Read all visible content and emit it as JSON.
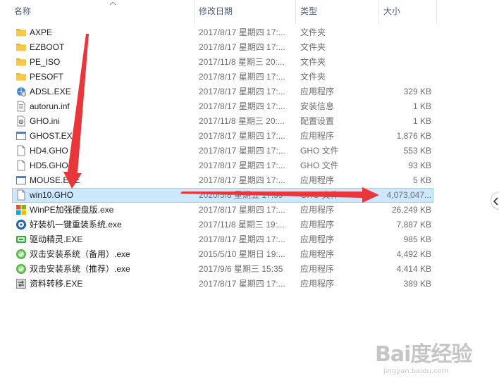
{
  "columns": {
    "name": "名称",
    "date": "修改日期",
    "type": "类型",
    "size": "大小"
  },
  "files": [
    {
      "name": "AXPE",
      "date": "2017/8/17 星期四 17:...",
      "type": "文件夹",
      "size": "",
      "icon": "folder-icon"
    },
    {
      "name": "EZBOOT",
      "date": "2017/8/17 星期四 17:...",
      "type": "文件夹",
      "size": "",
      "icon": "folder-icon"
    },
    {
      "name": "PE_ISO",
      "date": "2017/11/8 星期三 20:...",
      "type": "文件夹",
      "size": "",
      "icon": "folder-icon"
    },
    {
      "name": "PESOFT",
      "date": "2017/8/17 星期四 17:...",
      "type": "文件夹",
      "size": "",
      "icon": "folder-icon"
    },
    {
      "name": "ADSL.EXE",
      "date": "2017/8/17 星期四 17:...",
      "type": "应用程序",
      "size": "329 KB",
      "icon": "network-app-icon"
    },
    {
      "name": "autorun.inf",
      "date": "2017/8/17 星期四 17:...",
      "type": "安装信息",
      "size": "1 KB",
      "icon": "setup-info-icon"
    },
    {
      "name": "GHO.ini",
      "date": "2017/11/8 星期三 20:...",
      "type": "配置设置",
      "size": "1 KB",
      "icon": "config-file-icon"
    },
    {
      "name": "GHOST.EXE",
      "date": "2017/8/17 星期四 17:...",
      "type": "应用程序",
      "size": "1,876 KB",
      "icon": "app-window-icon"
    },
    {
      "name": "HD4.GHO",
      "date": "2017/8/17 星期四 17:...",
      "type": "GHO 文件",
      "size": "553 KB",
      "icon": "blank-file-icon"
    },
    {
      "name": "HD5.GHO",
      "date": "2017/8/17 星期四 17:...",
      "type": "GHO 文件",
      "size": "93 KB",
      "icon": "blank-file-icon"
    },
    {
      "name": "MOUSE.EXE",
      "date": "2017/8/17 星期四 17:...",
      "type": "应用程序",
      "size": "5 KB",
      "icon": "app-window-icon"
    },
    {
      "name": "win10.GHO",
      "date": "2020/5/8 星期五 17:59",
      "type": "GHO 文件",
      "size": "4,073,047...",
      "icon": "blank-file-icon",
      "selected": true
    },
    {
      "name": "WinPE加强硬盘版.exe",
      "date": "2017/8/17 星期四 17:...",
      "type": "应用程序",
      "size": "26,249 KB",
      "icon": "winpe-app-icon"
    },
    {
      "name": "好装机一键重装系统.exe",
      "date": "2017/11/8 星期三 19:...",
      "type": "应用程序",
      "size": "7,887 KB",
      "icon": "installer-disc-icon"
    },
    {
      "name": "驱动精灵.EXE",
      "date": "2017/8/17 星期四 17:...",
      "type": "应用程序",
      "size": "985 KB",
      "icon": "driver-app-icon"
    },
    {
      "name": "双击安装系统（备用）.exe",
      "date": "2015/5/10 星期日 19:...",
      "type": "应用程序",
      "size": "4,492 KB",
      "icon": "install-system-icon"
    },
    {
      "name": "双击安装系统（推荐）.exe",
      "date": "2017/9/6 星期三 15:35",
      "type": "应用程序",
      "size": "4,414 KB",
      "icon": "install-system-icon"
    },
    {
      "name": "资料转移.EXE",
      "date": "2017/8/17 星期四 17:...",
      "type": "应用程序",
      "size": "389 KB",
      "icon": "transfer-app-icon"
    }
  ],
  "watermark": {
    "brand": "Bai度经验",
    "site": "jingyan.baidu.com"
  },
  "colors": {
    "selection": "#cce8ff",
    "selection_border": "#99d1ff",
    "arrow": "#e8363a",
    "folder": "#f7c948"
  }
}
